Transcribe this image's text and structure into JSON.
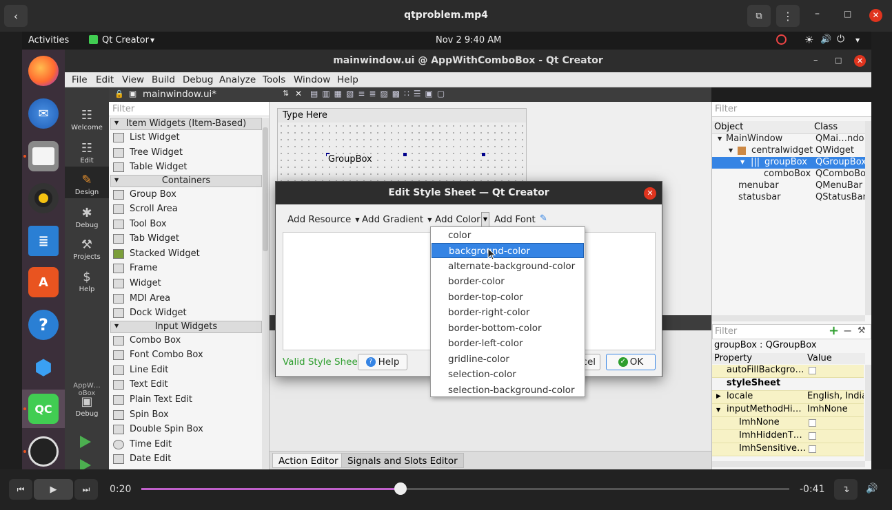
{
  "player": {
    "title": "qtproblem.mp4",
    "elapsed": "0:20",
    "remaining": "-0:41",
    "progress_fraction": 0.4
  },
  "gnome": {
    "activities": "Activities",
    "app_menu": "Qt Creator",
    "clock": "Nov 2  9:40 AM"
  },
  "qt": {
    "window_title": "mainwindow.ui @ AppWithComboBox - Qt Creator",
    "menu": [
      "File",
      "Edit",
      "View",
      "Build",
      "Debug",
      "Analyze",
      "Tools",
      "Window",
      "Help"
    ],
    "modes": [
      "Welcome",
      "Edit",
      "Design",
      "Debug",
      "Projects",
      "Help"
    ],
    "project_label": "AppW…oBox",
    "run_debug": "Debug",
    "open_file": "mainwindow.ui*",
    "widget_filter_placeholder": "Filter",
    "widget_box": {
      "cat_item": "Item Widgets (Item-Based)",
      "items1": [
        "List Widget",
        "Tree Widget",
        "Table Widget"
      ],
      "cat_containers": "Containers",
      "items2": [
        "Group Box",
        "Scroll Area",
        "Tool Box",
        "Tab Widget",
        "Stacked Widget",
        "Frame",
        "Widget",
        "MDI Area",
        "Dock Widget"
      ],
      "cat_input": "Input Widgets",
      "items3": [
        "Combo Box",
        "Font Combo Box",
        "Line Edit",
        "Text Edit",
        "Plain Text Edit",
        "Spin Box",
        "Double Spin Box",
        "Time Edit",
        "Date Edit"
      ]
    },
    "form": {
      "type_here": "Type Here",
      "groupbox": "GroupBox"
    },
    "bottom_tabs": [
      "Action Editor",
      "Signals and Slots Editor"
    ],
    "object_inspector": {
      "filter_placeholder": "Filter",
      "col_object": "Object",
      "col_class": "Class",
      "rows": [
        {
          "object": "MainWindow",
          "class": "QMai…ndo"
        },
        {
          "object": "centralwidget",
          "class": "QWidget"
        },
        {
          "object": "groupBox",
          "class": "QGroupBox"
        },
        {
          "object": "comboBox",
          "class": "QComboBo"
        },
        {
          "object": "menubar",
          "class": "QMenuBar"
        },
        {
          "object": "statusbar",
          "class": "QStatusBar"
        }
      ]
    },
    "property_editor": {
      "filter_placeholder": "Filter",
      "selection": "groupBox : QGroupBox",
      "col_property": "Property",
      "col_value": "Value",
      "rows": [
        {
          "name": "autoFillBackgro…",
          "value": ""
        },
        {
          "name": "styleSheet",
          "value": ""
        },
        {
          "name": "locale",
          "value": "English, India"
        },
        {
          "name": "inputMethodHi…",
          "value": "ImhNone"
        },
        {
          "name": "ImhNone",
          "value": ""
        },
        {
          "name": "ImhHiddenT…",
          "value": ""
        },
        {
          "name": "ImhSensitive…",
          "value": ""
        }
      ]
    }
  },
  "dialog": {
    "title": "Edit Style Sheet — Qt Creator",
    "add_resource": "Add Resource",
    "add_gradient": "Add Gradient",
    "add_color": "Add Color",
    "add_font": "Add Font",
    "status": "Valid Style Sheet",
    "help": "Help",
    "cancel_partial": "cel",
    "ok": "OK",
    "color_options": [
      "color",
      "background-color",
      "alternate-background-color",
      "border-color",
      "border-top-color",
      "border-right-color",
      "border-bottom-color",
      "border-left-color",
      "gridline-color",
      "selection-color",
      "selection-background-color"
    ],
    "selected_index": 1
  },
  "colors": {
    "accent": "#3584e4",
    "valid_green": "#2e9e2e",
    "close_red": "#e0341e",
    "property_yellow": "#f7f2c6"
  }
}
